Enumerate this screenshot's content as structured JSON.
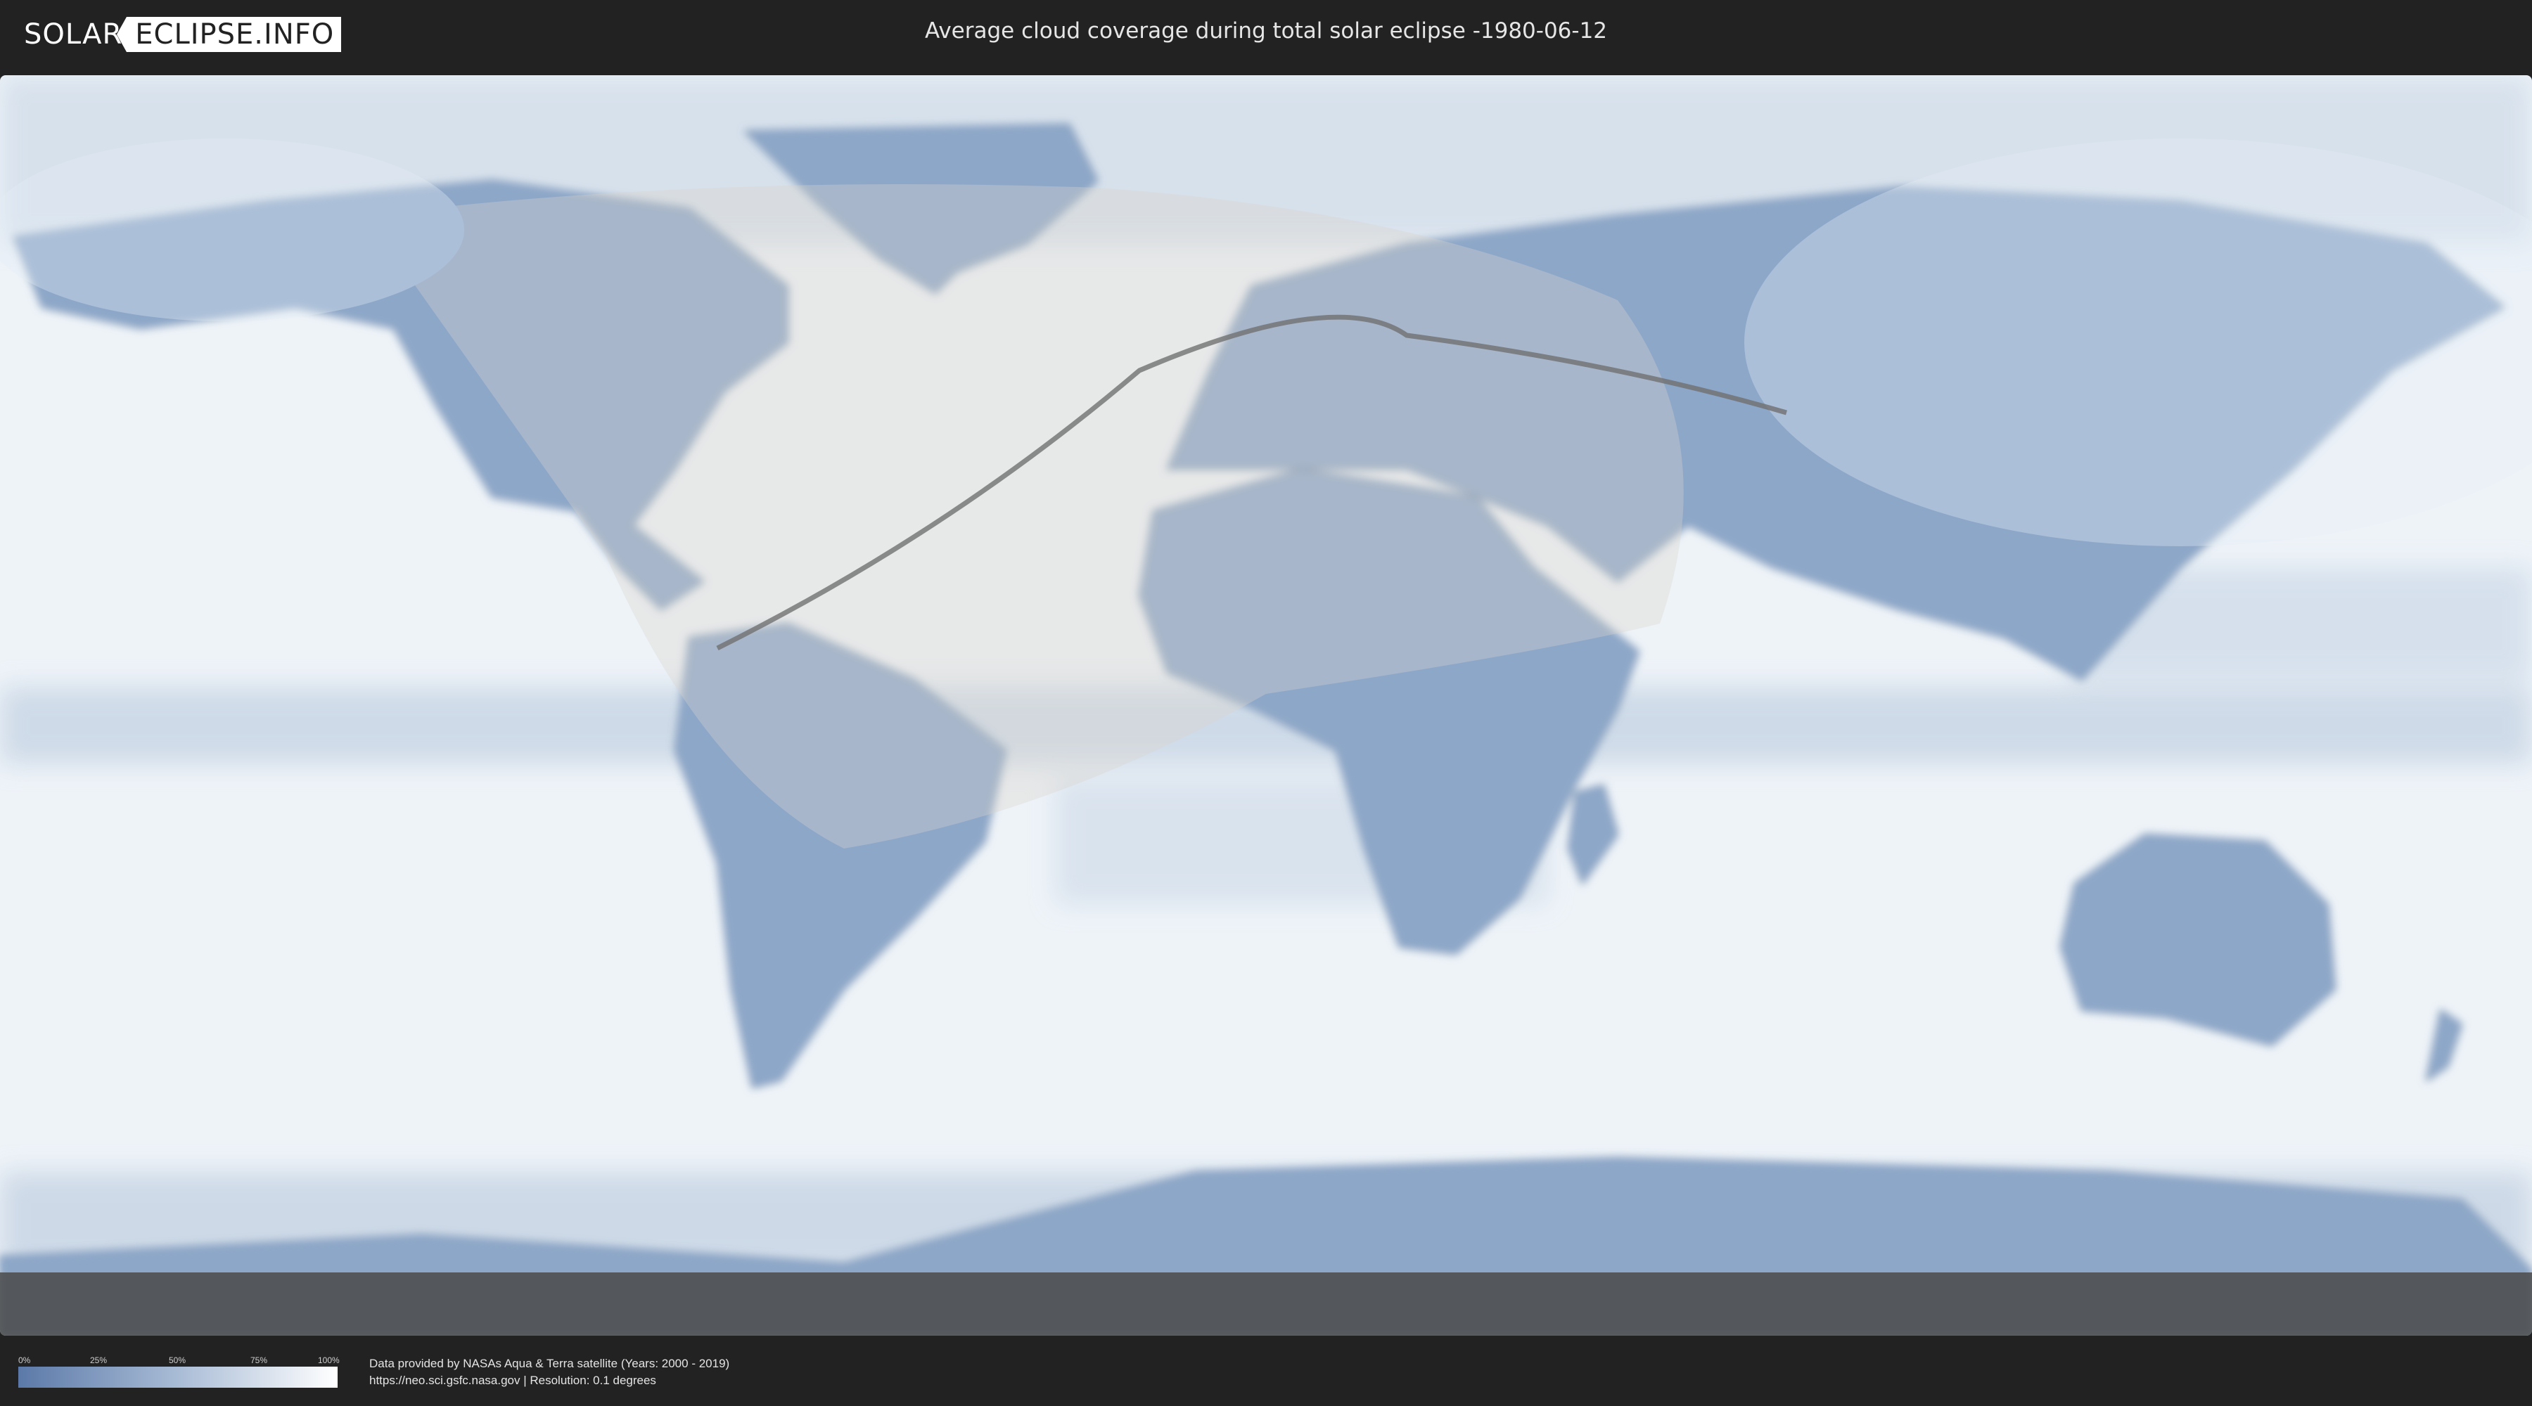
{
  "header": {
    "logo_solar": "SOLAR",
    "logo_eclipse": "ECLIPSE.INFO",
    "title": "Average cloud coverage during total solar eclipse -1980-06-12"
  },
  "map": {
    "projection": "equirectangular",
    "ocean_color": "#eef3f8",
    "land_color": "#8da7c9",
    "overlay_color": "#d9d4cc",
    "path_color": "#707070"
  },
  "legend": {
    "ticks": [
      "0%",
      "25%",
      "50%",
      "75%",
      "100%"
    ],
    "color_low": "#5b79a8",
    "color_high": "#ffffff"
  },
  "footer": {
    "line1": "Data provided by NASAs Aqua & Terra satellite (Years: 2000 - 2019)",
    "line2": "https://neo.sci.gsfc.nasa.gov | Resolution: 0.1 degrees"
  }
}
